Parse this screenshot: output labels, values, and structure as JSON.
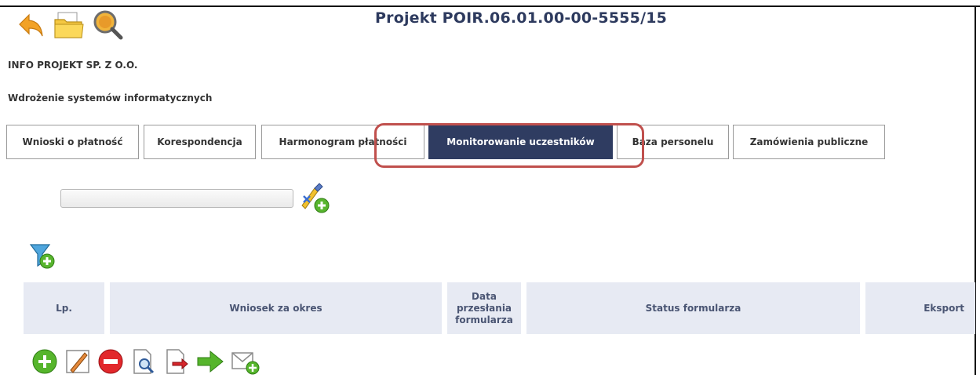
{
  "header": {
    "title": "Projekt POIR.06.01.00-00-5555/15",
    "company": "INFO PROJEKT SP. Z O.O.",
    "project_name": "Wdrożenie systemów informatycznych",
    "icons": [
      "back-arrow-icon",
      "folder-icon",
      "search-coin-icon"
    ]
  },
  "tabs": [
    {
      "label": "Wnioski o płatność",
      "active": false
    },
    {
      "label": "Korespondencja",
      "active": false
    },
    {
      "label": "Harmonogram płatności",
      "active": false
    },
    {
      "label": "Monitorowanie uczestników",
      "active": true
    },
    {
      "label": "Baza personelu",
      "active": false
    },
    {
      "label": "Zamówienia publiczne",
      "active": false
    }
  ],
  "search": {
    "value": "",
    "placeholder": "",
    "icon": "edit-add-icon"
  },
  "filter": {
    "icon": "filter-add-icon"
  },
  "table": {
    "columns": [
      "Lp.",
      "Wniosek za okres",
      "Data przesłania formularza",
      "Status formularza",
      "Eksport"
    ]
  },
  "actions": [
    "add-icon",
    "edit-icon",
    "delete-icon",
    "preview-icon",
    "export-icon",
    "submit-arrow-icon",
    "message-icon"
  ],
  "colors": {
    "title": "#2d3a5e",
    "active_tab": "#2f3c61",
    "highlight": "#c0504d",
    "table_header": "#e7eaf3"
  }
}
